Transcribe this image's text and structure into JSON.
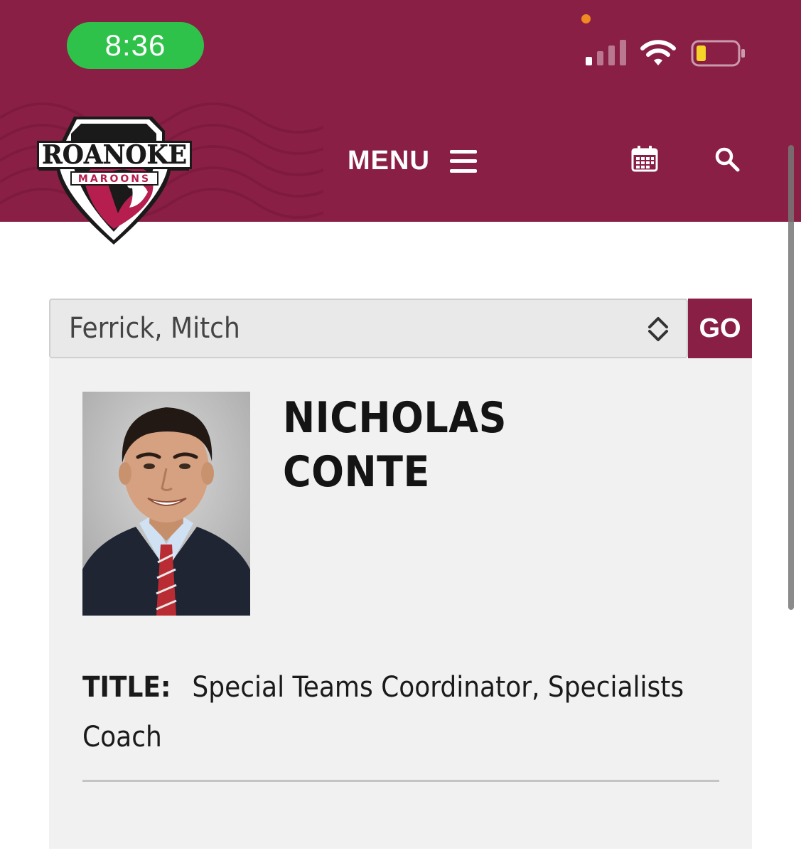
{
  "status_bar": {
    "time": "8:36",
    "icons": [
      "cellular-signal-icon",
      "wifi-icon",
      "battery-low-icon"
    ],
    "battery_color": "#f5d327"
  },
  "header": {
    "logo_text": "ROANOKE",
    "logo_subtext": "MAROONS",
    "menu_label": "MENU",
    "icons": [
      "menu-icon",
      "calendar-icon",
      "search-icon"
    ],
    "background_color": "#8a1f45"
  },
  "roster_select": {
    "selected": "Ferrick, Mitch",
    "go_label": "GO"
  },
  "profile": {
    "first_name": "NICHOLAS",
    "last_name": "CONTE",
    "title_label": "TITLE:",
    "title_value": "Special Teams Coordinator, Specialists Coach"
  },
  "colors": {
    "accent": "#8a1f45",
    "time_pill": "#2fc24a",
    "card_bg": "#f1f1f1"
  }
}
